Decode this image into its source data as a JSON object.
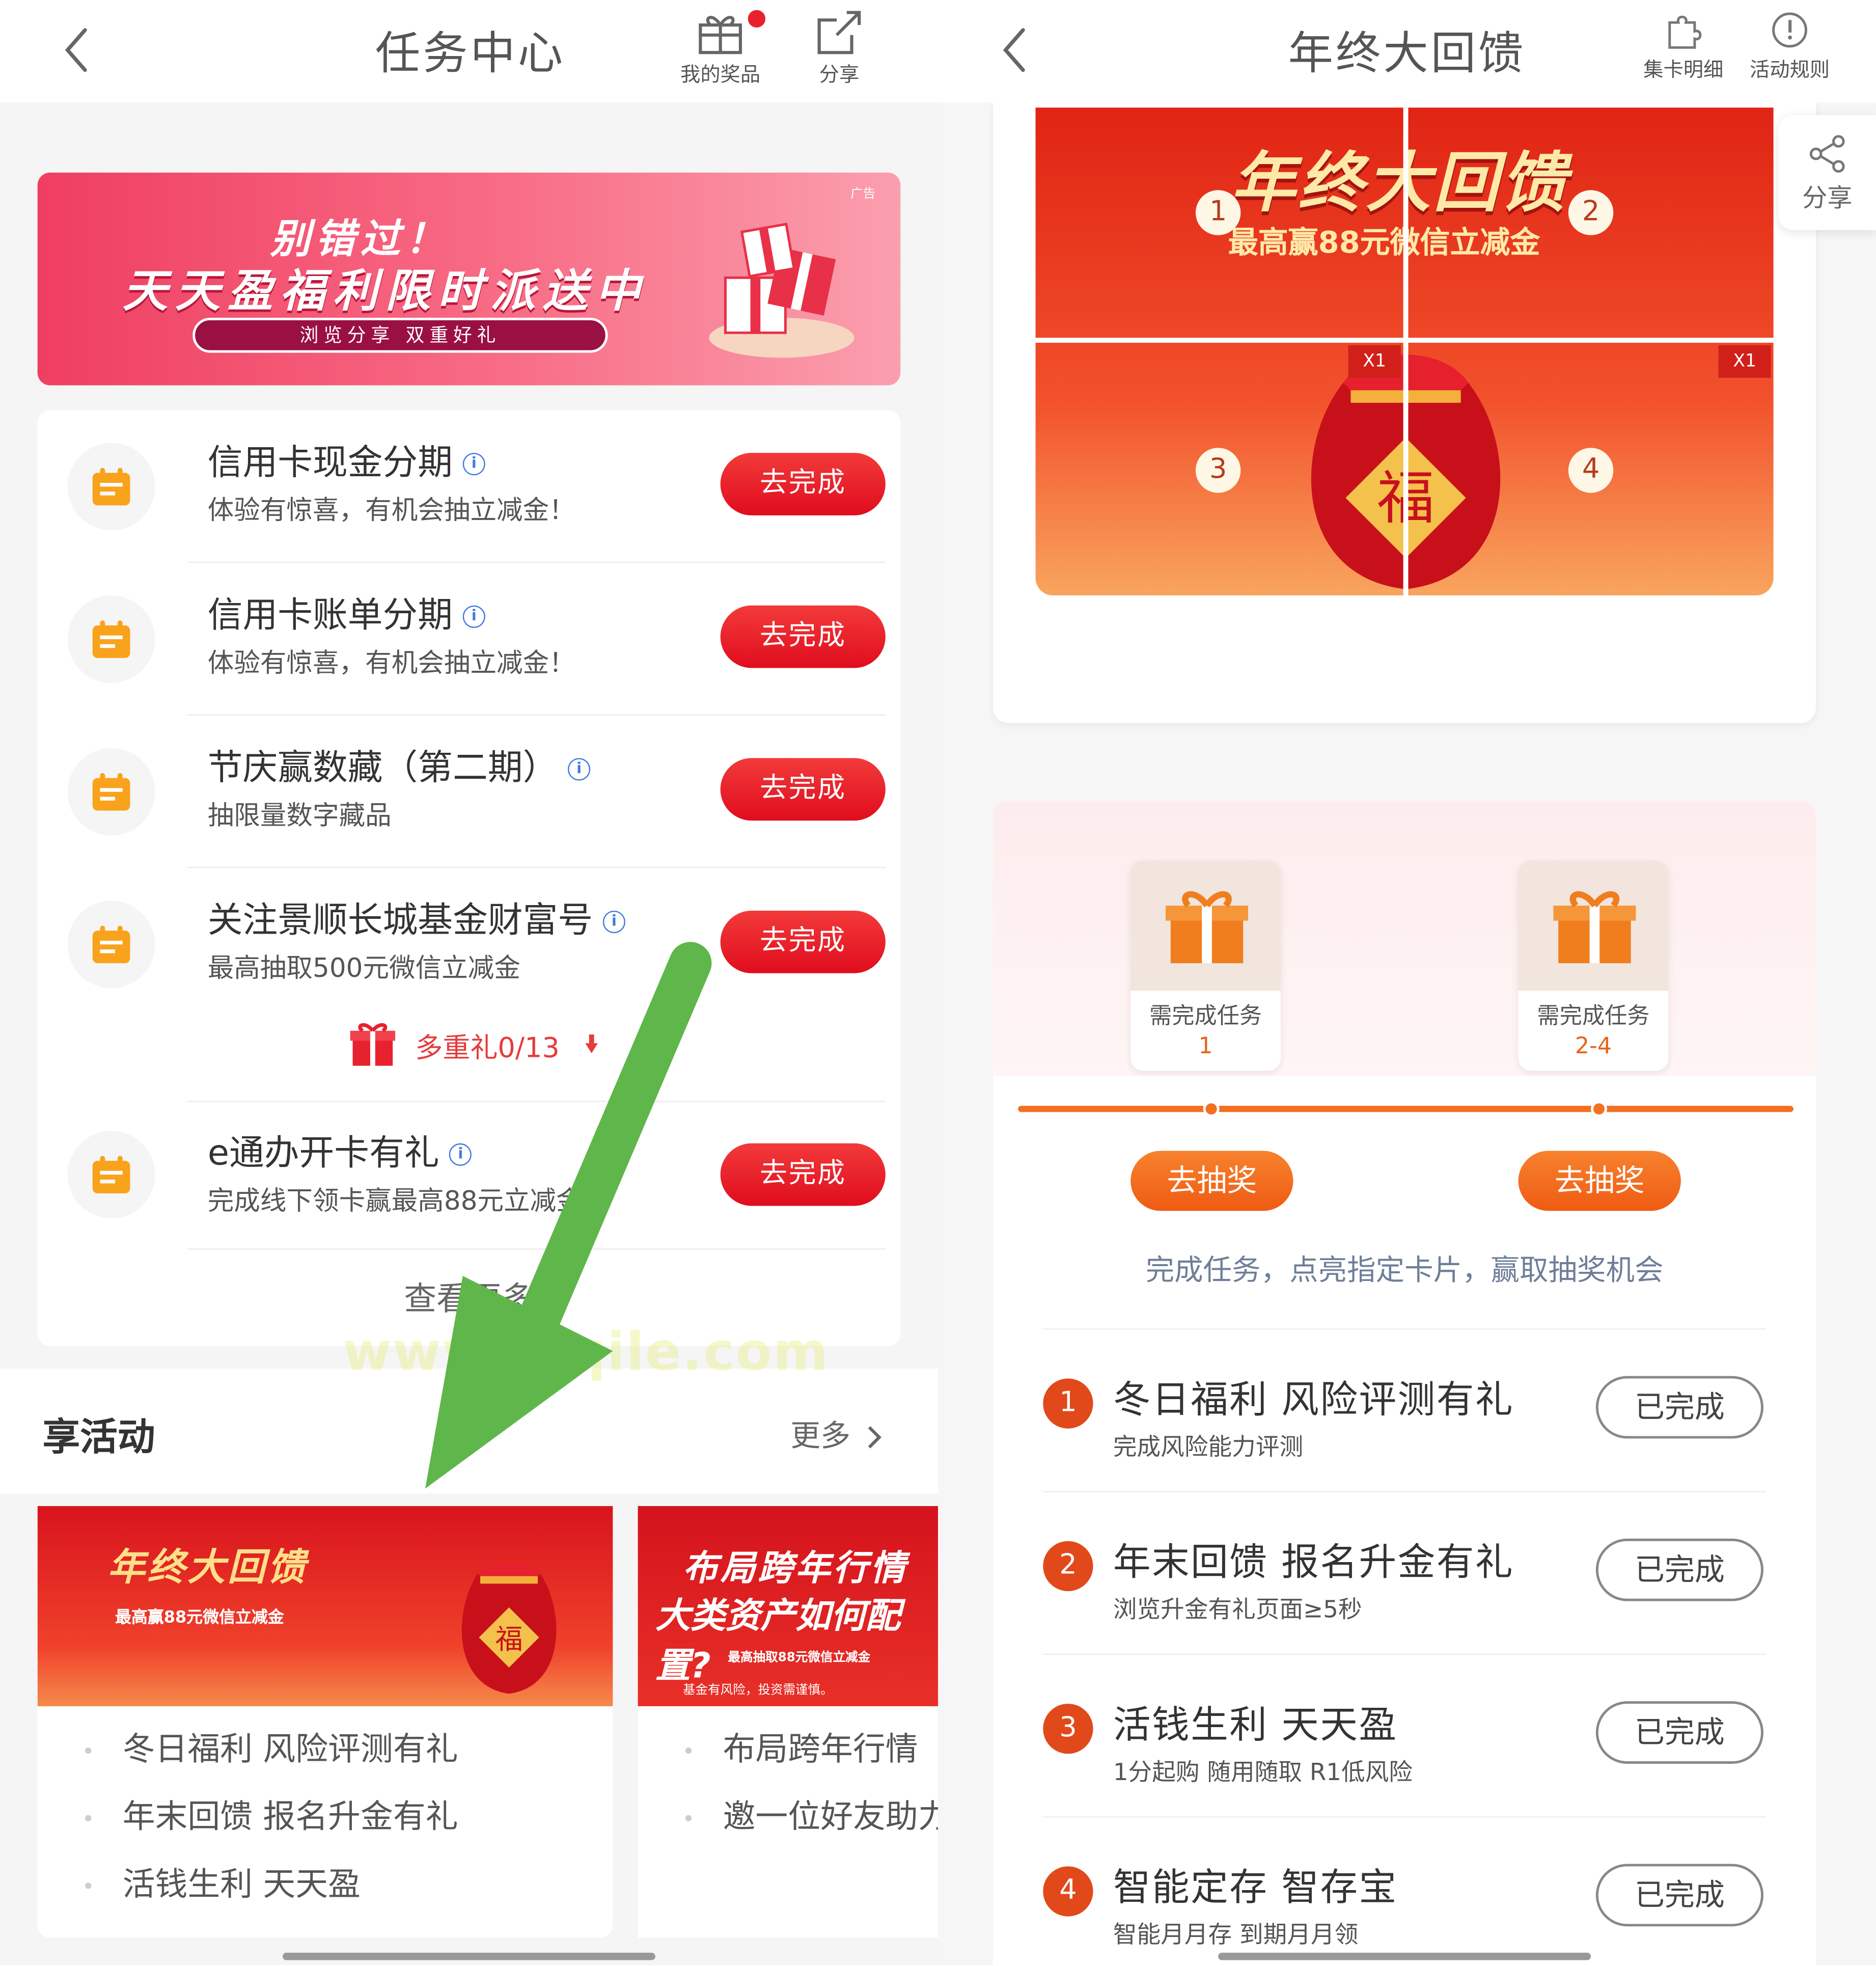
{
  "left": {
    "header": {
      "title": "任务中心",
      "prizes_label": "我的奖品",
      "share_label": "分享"
    },
    "banner": {
      "line1": "别错过！",
      "line2": "天天盈福利限时派送中",
      "line3": "浏览分享 双重好礼",
      "ad_tag": "广告"
    },
    "tasks": [
      {
        "title": "信用卡现金分期",
        "subtitle": "体验有惊喜，有机会抽立减金！",
        "button": "去完成"
      },
      {
        "title": "信用卡账单分期",
        "subtitle": "体验有惊喜，有机会抽立减金！",
        "button": "去完成"
      },
      {
        "title": "节庆赢数藏（第二期）",
        "subtitle": "抽限量数字藏品",
        "button": "去完成"
      },
      {
        "title": "关注景顺长城基金财富号",
        "subtitle": "最高抽取500元微信立减金",
        "button": "去完成"
      },
      {
        "title": "e通办开卡有礼",
        "subtitle": "完成线下领卡赢最高88元立减金",
        "button": "去完成"
      }
    ],
    "multi_gift": "多重礼0/13",
    "view_more": "查看更多",
    "section": {
      "title": "享活动",
      "more": "更多"
    },
    "activity1": {
      "img_title": "年终大回馈",
      "img_sub": "最高赢88元微信立减金",
      "items": [
        "冬日福利 风险评测有礼",
        "年末回馈 报名升金有礼",
        "活钱生利 天天盈"
      ]
    },
    "activity2": {
      "img_title1": "布局跨年行情",
      "img_title2": "大类资产如何配置?",
      "img_sub": "最高抽取88元微信立减金",
      "img_note": "基金有风险，投资需谨慎。",
      "items": [
        "布局跨年行情",
        "邀一位好友助力"
      ]
    },
    "watermark": "www.diqile.com"
  },
  "right": {
    "header": {
      "title": "年终大回馈",
      "cards_label": "集卡明细",
      "rules_label": "活动规则"
    },
    "share_float": "分享",
    "puzzle": {
      "title": "年终大回馈",
      "subtitle": "最高赢88元微信立减金",
      "numbers": [
        "1",
        "2",
        "3",
        "4"
      ],
      "count_label": "X1"
    },
    "rewards": [
      {
        "line1": "需完成任务",
        "line2": "1",
        "button": "去抽奖"
      },
      {
        "line1": "需完成任务",
        "line2": "2-4",
        "button": "去抽奖"
      }
    ],
    "desc": "完成任务，点亮指定卡片，赢取抽奖机会",
    "tasks": [
      {
        "num": "1",
        "title": "冬日福利 风险评测有礼",
        "subtitle": "完成风险能力评测",
        "status": "已完成"
      },
      {
        "num": "2",
        "title": "年末回馈 报名升金有礼",
        "subtitle": "浏览升金有礼页面≥5秒",
        "status": "已完成"
      },
      {
        "num": "3",
        "title": "活钱生利 天天盈",
        "subtitle": "1分起购 随用随取 R1低风险",
        "status": "已完成"
      },
      {
        "num": "4",
        "title": "智能定存 智存宝",
        "subtitle": "智能月月存 到期月月领",
        "status": "已完成"
      }
    ]
  },
  "colors": {
    "primary_red": "#e00d1e",
    "orange": "#f37021",
    "info_blue": "#3f7be0",
    "arrow_green": "#5fb64a"
  }
}
